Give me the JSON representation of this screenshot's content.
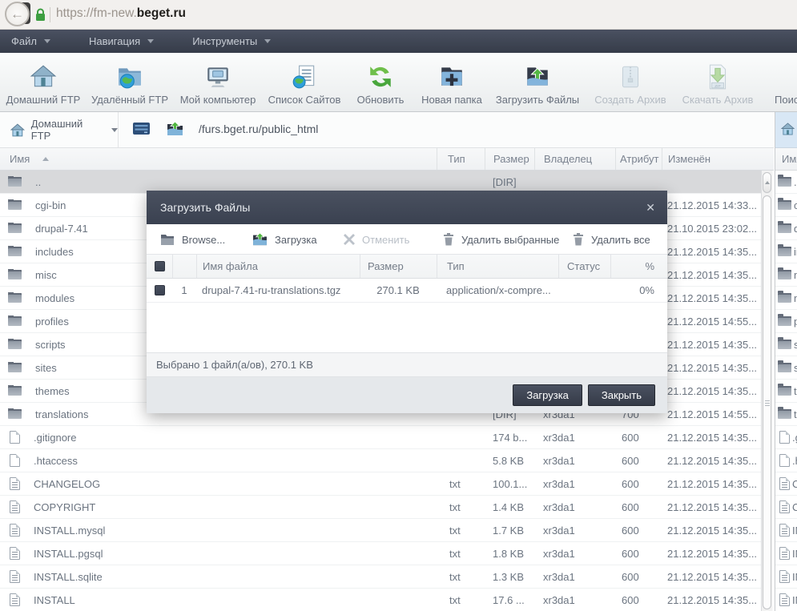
{
  "browser": {
    "url_prefix": "https://fm-new.",
    "url_domain": "beget.ru"
  },
  "menubar": {
    "items": [
      {
        "label": "Файл"
      },
      {
        "label": "Навигация"
      },
      {
        "label": "Инструменты"
      }
    ]
  },
  "toolbar": {
    "items": [
      {
        "label": "Домашний FTP",
        "icon": "home-ftp-icon",
        "disabled": false
      },
      {
        "label": "Удалённый FTP",
        "icon": "remote-ftp-icon",
        "disabled": false
      },
      {
        "label": "Мой компьютер",
        "icon": "my-computer-icon",
        "disabled": false
      },
      {
        "label": "Список Сайтов",
        "icon": "site-list-icon",
        "disabled": false
      },
      {
        "label": "Обновить",
        "icon": "refresh-icon",
        "disabled": false
      },
      {
        "label": "Новая папка",
        "icon": "new-folder-icon",
        "disabled": false
      },
      {
        "label": "Загрузить Файлы",
        "icon": "upload-files-icon",
        "disabled": false
      },
      {
        "label": "Создать Архив",
        "icon": "create-archive-icon",
        "disabled": true
      },
      {
        "label": "Скачать Архив",
        "icon": "download-archive-icon",
        "disabled": true
      },
      {
        "label": "Поиск Файлов",
        "icon": "file-search-icon",
        "disabled": false
      }
    ]
  },
  "pathbar": {
    "source_label": "Домашний FTP",
    "path": "/furs.bget.ru/public_html"
  },
  "file_table": {
    "columns": {
      "name": "Имя",
      "type": "Тип",
      "size": "Размер",
      "owner": "Владелец",
      "attr": "Атрибут",
      "modified": "Изменён"
    },
    "rows": [
      {
        "icon": "folder",
        "name": "..",
        "size": "[DIR]",
        "selected": true
      },
      {
        "icon": "folder",
        "name": "cgi-bin",
        "modified": "21.12.2015 14:33..."
      },
      {
        "icon": "folder",
        "name": "drupal-7.41",
        "modified": "21.10.2015 23:02..."
      },
      {
        "icon": "folder",
        "name": "includes",
        "modified": "21.12.2015 14:35..."
      },
      {
        "icon": "folder",
        "name": "misc",
        "modified": "21.12.2015 14:35..."
      },
      {
        "icon": "folder",
        "name": "modules",
        "modified": "21.12.2015 14:35..."
      },
      {
        "icon": "folder",
        "name": "profiles",
        "modified": "21.12.2015 14:55..."
      },
      {
        "icon": "folder",
        "name": "scripts",
        "modified": "21.12.2015 14:35..."
      },
      {
        "icon": "folder",
        "name": "sites",
        "modified": "21.12.2015 14:35..."
      },
      {
        "icon": "folder",
        "name": "themes",
        "modified": "21.12.2015 14:35..."
      },
      {
        "icon": "folder",
        "name": "translations",
        "size": "[DIR]",
        "owner": "xr3da1",
        "attr": "700",
        "modified": "21.12.2015 14:55..."
      },
      {
        "icon": "file",
        "name": ".gitignore",
        "size": "174 b...",
        "owner": "xr3da1",
        "attr": "600",
        "modified": "21.12.2015 14:35..."
      },
      {
        "icon": "file",
        "name": ".htaccess",
        "size": "5.8 KB",
        "owner": "xr3da1",
        "attr": "600",
        "modified": "21.12.2015 14:35..."
      },
      {
        "icon": "file-text",
        "name": "CHANGELOG",
        "type": "txt",
        "size": "100.1...",
        "owner": "xr3da1",
        "attr": "600",
        "modified": "21.12.2015 14:35..."
      },
      {
        "icon": "file-text",
        "name": "COPYRIGHT",
        "type": "txt",
        "size": "1.4 KB",
        "owner": "xr3da1",
        "attr": "600",
        "modified": "21.12.2015 14:35..."
      },
      {
        "icon": "file-text",
        "name": "INSTALL.mysql",
        "type": "txt",
        "size": "1.7 KB",
        "owner": "xr3da1",
        "attr": "600",
        "modified": "21.12.2015 14:35..."
      },
      {
        "icon": "file-text",
        "name": "INSTALL.pgsql",
        "type": "txt",
        "size": "1.8 KB",
        "owner": "xr3da1",
        "attr": "600",
        "modified": "21.12.2015 14:35..."
      },
      {
        "icon": "file-text",
        "name": "INSTALL.sqlite",
        "type": "txt",
        "size": "1.3 KB",
        "owner": "xr3da1",
        "attr": "600",
        "modified": "21.12.2015 14:35..."
      },
      {
        "icon": "file-text",
        "name": "INSTALL",
        "type": "txt",
        "size": "17.6 ...",
        "owner": "xr3da1",
        "attr": "600",
        "modified": "21.12.2015 14:35..."
      }
    ]
  },
  "right_panel": {
    "name_header": "Имя"
  },
  "dialog": {
    "title": "Загрузить Файлы",
    "close_glyph": "✕",
    "toolbar": {
      "browse": "Browse...",
      "upload": "Загрузка",
      "cancel": "Отменить",
      "delete_selected": "Удалить выбранные",
      "delete_all": "Удалить все"
    },
    "columns": {
      "name": "Имя файла",
      "size": "Размер",
      "type": "Тип",
      "status": "Статус",
      "percent": "%"
    },
    "rows": [
      {
        "num": "1",
        "name": "drupal-7.41-ru-translations.tgz",
        "size": "270.1 KB",
        "type": "application/x-compre...",
        "status": "",
        "percent": "0%",
        "checked": true
      }
    ],
    "status_text": "Выбрано 1 файл(а/ов), 270.1 KB",
    "buttons": {
      "upload": "Загрузка",
      "close": "Закрыть"
    }
  },
  "colors": {
    "dark_bar": "#3b4150",
    "selection_row": "#d8d9db",
    "accent_green": "#4fb53f",
    "accent_blue": "#7fb3d9"
  }
}
